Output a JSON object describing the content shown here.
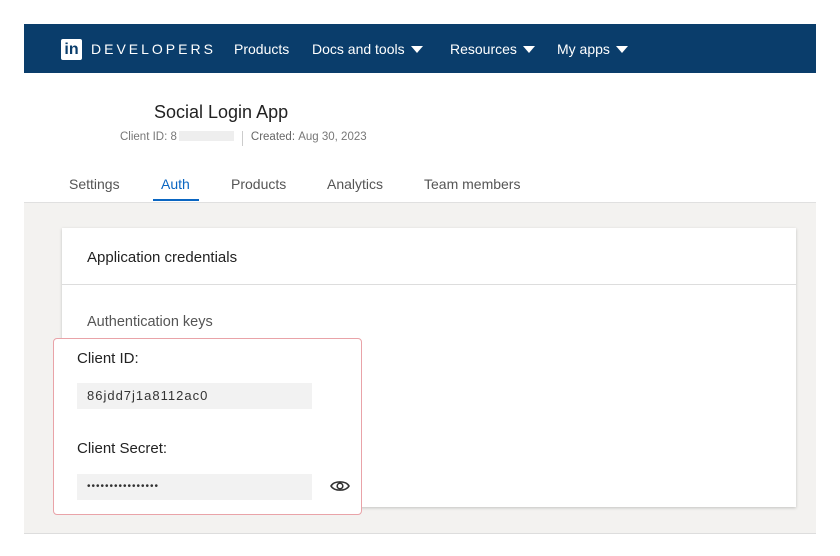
{
  "nav": {
    "logo": "in",
    "brand": "DEVELOPERS",
    "items": [
      {
        "label": "Products"
      },
      {
        "label": "Docs and tools"
      },
      {
        "label": "Resources"
      },
      {
        "label": "My apps"
      }
    ]
  },
  "app": {
    "title": "Social Login App",
    "client_id_label": "Client ID:",
    "client_id_value": "8",
    "created_label": "Created:",
    "created_value": "Aug 30, 2023"
  },
  "tabs": [
    {
      "label": "Settings"
    },
    {
      "label": "Auth"
    },
    {
      "label": "Products"
    },
    {
      "label": "Analytics"
    },
    {
      "label": "Team members"
    }
  ],
  "card": {
    "title": "Application credentials",
    "subtitle": "Authentication keys",
    "client_id_label": "Client ID:",
    "client_id_value": "86jdd7j1a8112ac0",
    "client_secret_label": "Client Secret:",
    "client_secret_value": "••••••••••••••••"
  }
}
